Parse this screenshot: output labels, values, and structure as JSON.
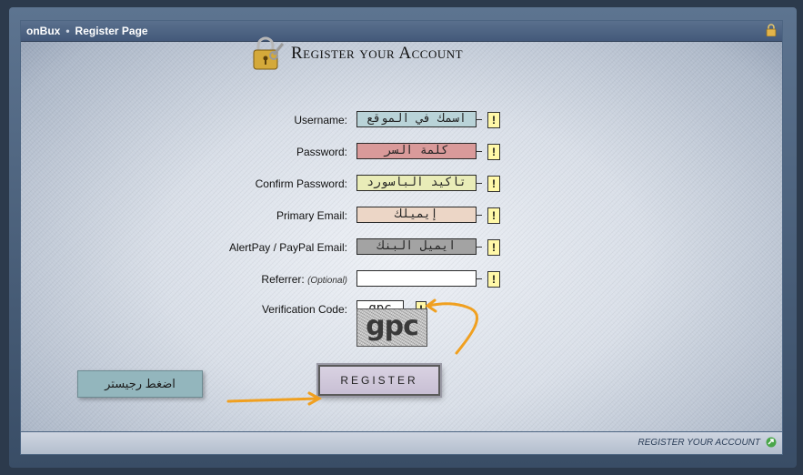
{
  "breadcrumb": {
    "site": "onBux",
    "separator": "•",
    "page": "Register Page"
  },
  "header": {
    "title": "Register your Account"
  },
  "form": {
    "fields": [
      {
        "label": "Username:",
        "value": "اسمك في الموقع",
        "bg": "#b9d3d8"
      },
      {
        "label": "Password:",
        "value": "كلمة السر",
        "bg": "#d99a9a"
      },
      {
        "label": "Confirm Password:",
        "value": "تأكيد الباسورد",
        "bg": "#e9ecb8"
      },
      {
        "label": "Primary Email:",
        "value": "إيميلك",
        "bg": "#ecd6c6"
      },
      {
        "label": "AlertPay / PayPal Email:",
        "value": "ايميل البنك",
        "bg": "#a3a3a3"
      },
      {
        "label": "Referrer:",
        "label_note": "(Optional)",
        "value": "",
        "bg": "#ffffff"
      }
    ],
    "verification": {
      "label": "Verification Code:",
      "value": "gpc",
      "captcha_text": "gpc"
    },
    "help_glyph": "!",
    "register_label": "REGISTER"
  },
  "annotation": {
    "note": "اضغط رجيستر",
    "arrow_color": "#f0a020"
  },
  "footer": {
    "link": "REGISTER YOUR ACCOUNT"
  }
}
